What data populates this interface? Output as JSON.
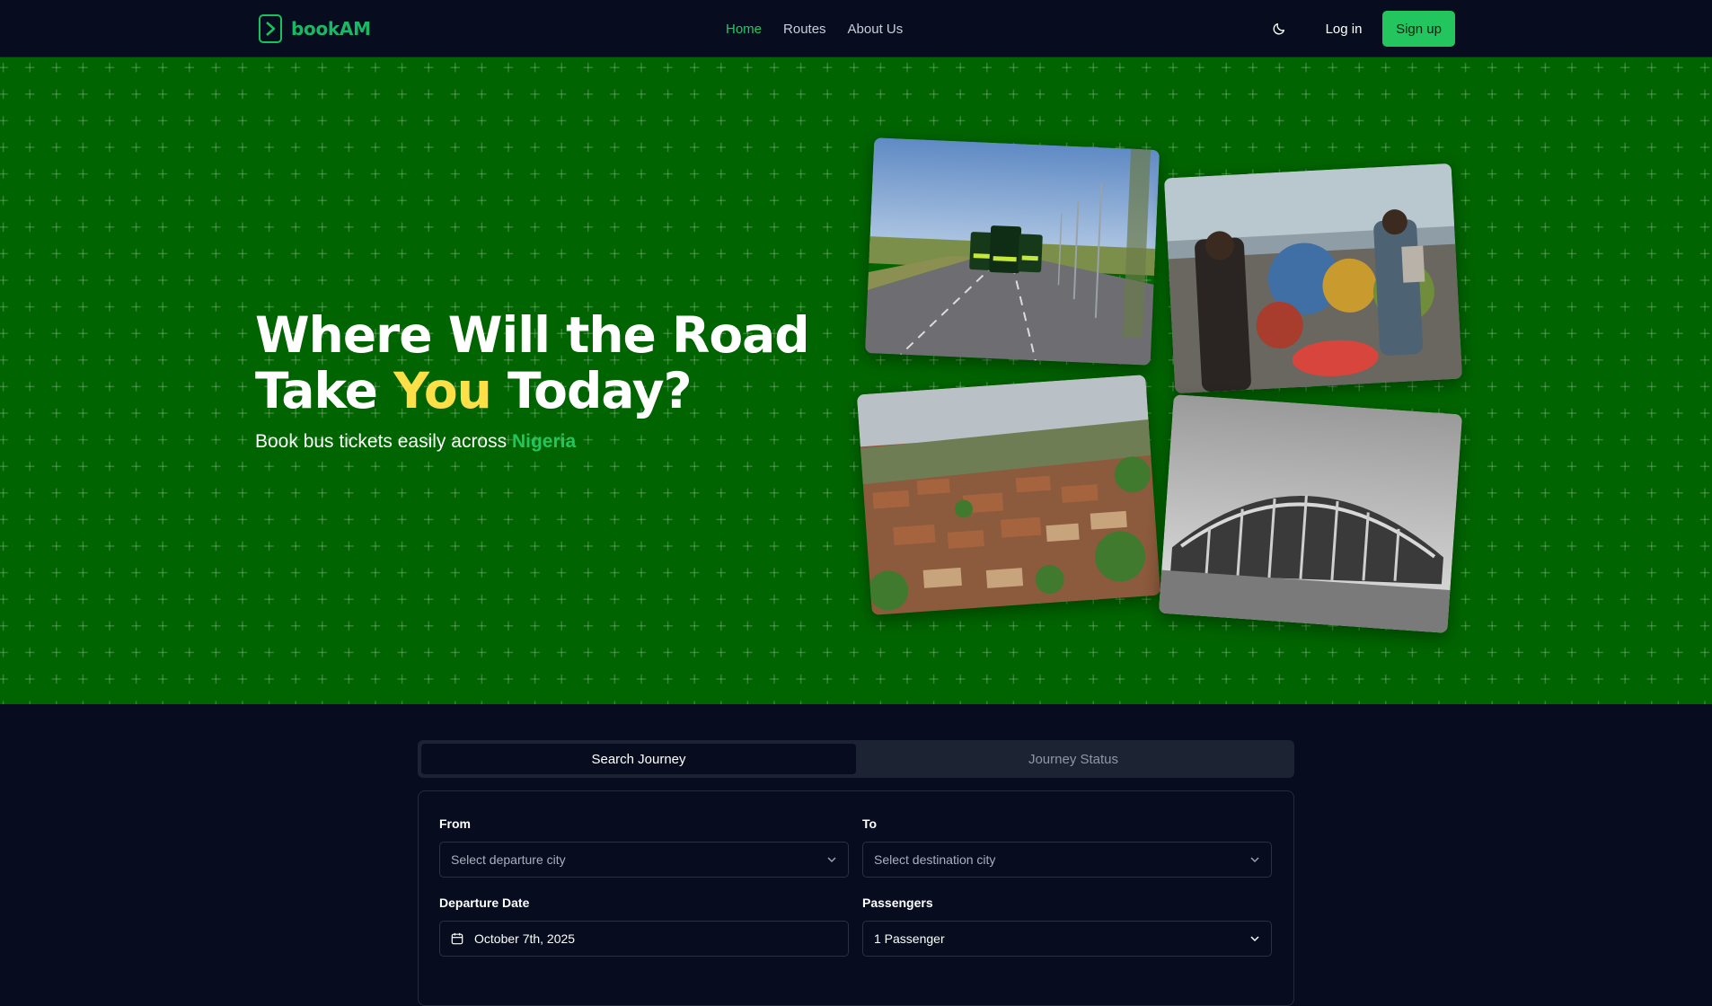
{
  "brand": {
    "name": "bookAM",
    "color": "#19b865"
  },
  "nav": {
    "links": [
      {
        "label": "Home",
        "active": true
      },
      {
        "label": "Routes",
        "active": false
      },
      {
        "label": "About Us",
        "active": false
      }
    ],
    "theme_toggle_icon": "moon-icon",
    "login_label": "Log in",
    "signup_label": "Sign up"
  },
  "hero": {
    "title_line1": "Where Will the Road",
    "title_line2_pre": "Take ",
    "title_line2_accent": "You",
    "title_line2_post": " Today?",
    "subtitle_pre": "Book bus tickets easily across ",
    "subtitle_accent": "Nigeria",
    "background_color": "#006400",
    "accent_yellow": "#fde047",
    "accent_green": "#22c55e"
  },
  "search": {
    "tabs": [
      {
        "label": "Search Journey",
        "active": true
      },
      {
        "label": "Journey Status",
        "active": false
      }
    ],
    "from_label": "From",
    "from_placeholder": "Select departure city",
    "to_label": "To",
    "to_placeholder": "Select destination city",
    "date_label": "Departure Date",
    "date_value": "October 7th, 2025",
    "passengers_label": "Passengers",
    "passengers_value": "1 Passenger"
  }
}
